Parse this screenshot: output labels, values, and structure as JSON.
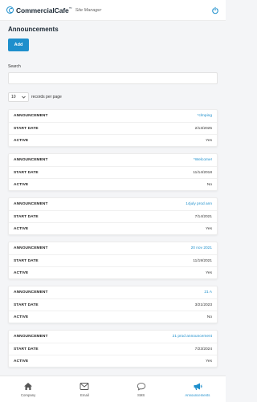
{
  "header": {
    "brand": "CommercialCafe",
    "tm": "™",
    "sub": "Site Manager"
  },
  "page": {
    "title": "Announcements",
    "add_label": "Add",
    "search_label": "Search",
    "search_value": "",
    "page_length": "10",
    "page_length_text": "records per page"
  },
  "field_labels": {
    "announcement": "ANNOUNCEMENT",
    "start_date": "START DATE",
    "active": "ACTIVE"
  },
  "announcements": [
    {
      "title": "*clmping",
      "start_date": "2/13/2025",
      "active": "Yes"
    },
    {
      "title": "*Welcome!",
      "start_date": "11/14/2018",
      "active": "No"
    },
    {
      "title": "14july prod ann",
      "start_date": "7/14/2021",
      "active": "Yes"
    },
    {
      "title": "20 nov 2021",
      "start_date": "11/19/2021",
      "active": "Yes"
    },
    {
      "title": "21 A",
      "start_date": "3/21/2023",
      "active": "No"
    },
    {
      "title": "21 prod announcement",
      "start_date": "7/23/2024",
      "active": "Yes"
    }
  ],
  "nav": {
    "items": [
      {
        "label": "Company"
      },
      {
        "label": "Email"
      },
      {
        "label": "SMS"
      },
      {
        "label": "Announcements"
      }
    ]
  },
  "colors": {
    "accent": "#1e8fcc",
    "background": "#f4f5f7"
  }
}
